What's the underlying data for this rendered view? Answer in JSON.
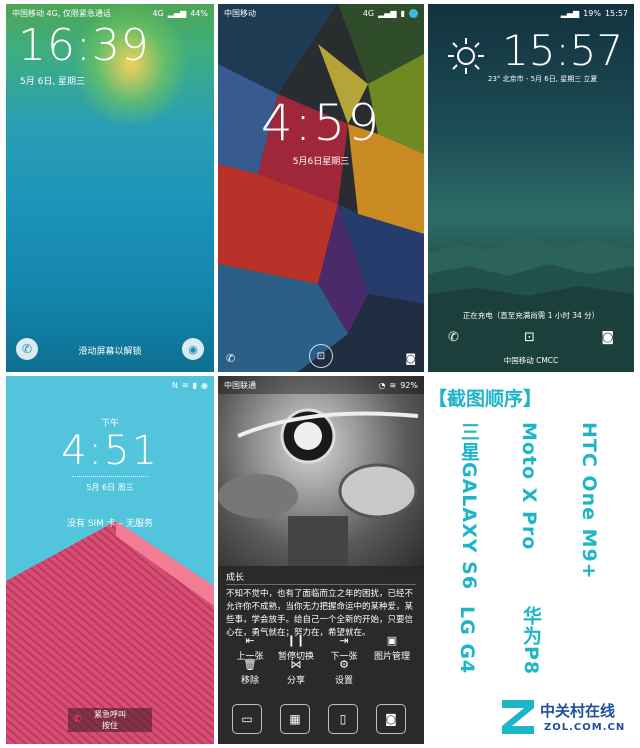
{
  "panels": {
    "galaxy": {
      "carrier": "中国移动 4G, 仅限紧急通话",
      "status_right": "4G",
      "battery": "44%",
      "time": "16:39",
      "date": "5月 6日, 星期三",
      "unlock_hint": "滑动屏幕以解锁",
      "colors": {
        "bg_top": "#3bb36a",
        "bg_bottom": "#0e86a8"
      }
    },
    "moto": {
      "carrier": "中国移动",
      "network": "4G",
      "time": "4:59",
      "date": "5月6日星期三"
    },
    "htc": {
      "time": "15:57",
      "battery": "19%",
      "status_time": "15:57",
      "weather": "23° 北京市 - 5月 6日, 星期三 立夏",
      "charging": "正在充电（直至充满尚需 1 小时 34 分）",
      "carrier": "中国移动 CMCC"
    },
    "lg": {
      "ampm": "下午",
      "time": "4:51",
      "date": "5月 6日 周三",
      "sim": "没有 SIM 卡 – 无服务",
      "emergency": "紧急呼叫",
      "hold": "按住",
      "colors": {
        "sky": "#52c5dc",
        "roof": "#d94c74"
      }
    },
    "huawei": {
      "carrier": "中国联通",
      "battery": "92%",
      "title": "成长",
      "text": "不知不觉中，也有了面临而立之年的困扰，已经不允许你不成熟，当你无力把握命运中的某种爱，某些事，学会放手。给自己一个全新的开始，只要信心在，勇气就在；努力在，希望就在。",
      "actions": [
        "上一张",
        "暂停切换",
        "下一张",
        "图片管理",
        "移除",
        "分享",
        "设置"
      ]
    }
  },
  "legend": {
    "heading": "【截图顺序】",
    "labels": [
      "HTC One M9+",
      "Moto X Pro",
      "三星GALAXY S6",
      "华为P8",
      "LG G4"
    ],
    "logo_text": "中关村在线",
    "logo_url": "ZOL.COM.CN"
  }
}
